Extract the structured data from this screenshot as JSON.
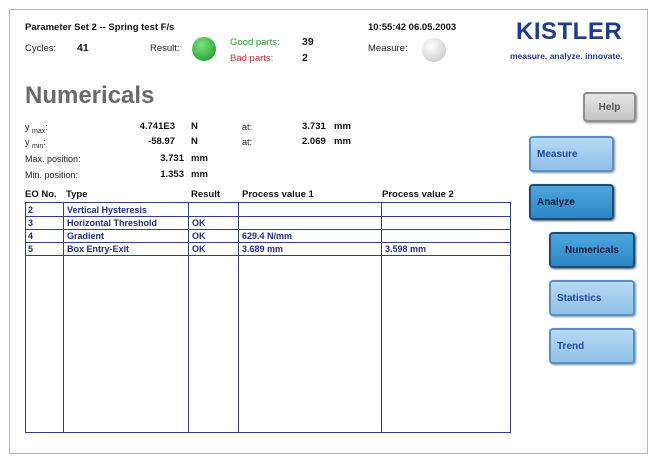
{
  "header": {
    "parameter_set": "Parameter Set 2  --  Spring test F/s",
    "datetime": "10:55:42  06.05.2003",
    "cycles_label": "Cycles:",
    "cycles_value": "41",
    "result_label": "Result:",
    "result_color": "#2fae3b",
    "good_parts_label": "Good parts:",
    "good_parts_value": "39",
    "bad_parts_label": "Bad parts:",
    "bad_parts_value": "2",
    "measure_label": "Measure:"
  },
  "logo": {
    "name": "KISTLER",
    "tagline": "measure. analyze. innovate."
  },
  "page_title": "Numericals",
  "stats": {
    "ymax_label_main": "y",
    "ymax_label_sub": "max",
    "ymax_value": "4.741E3",
    "ymax_unit": "N",
    "ymax_at_label": "at:",
    "ymax_at_value": "3.731",
    "ymax_at_unit": "mm",
    "ymin_label_main": "y",
    "ymin_label_sub": "min",
    "ymin_value": "-58.97",
    "ymin_unit": "N",
    "ymin_at_label": "at:",
    "ymin_at_value": "2.069",
    "ymin_at_unit": "mm",
    "maxpos_label": "Max. position:",
    "maxpos_value": "3.731",
    "maxpos_unit": "mm",
    "minpos_label": "Min. position:",
    "minpos_value": "1.353",
    "minpos_unit": "mm"
  },
  "table": {
    "headers": [
      "EO No.",
      "Type",
      "Result",
      "Process value 1",
      "Process value 2"
    ],
    "rows": [
      {
        "eo": "2",
        "type": "Vertical Hysteresis",
        "result": "",
        "pv1": "",
        "pv2": ""
      },
      {
        "eo": "3",
        "type": "Horizontal Threshold",
        "result": "OK",
        "pv1": "",
        "pv2": ""
      },
      {
        "eo": "4",
        "type": "Gradient",
        "result": "OK",
        "pv1": "629.4 N/mm",
        "pv2": ""
      },
      {
        "eo": "5",
        "type": "Box Entry-Exit",
        "result": "OK",
        "pv1": "3.689 mm",
        "pv2": "3.598 mm"
      }
    ]
  },
  "nav": {
    "help": "Help",
    "measure": "Measure",
    "analyze": "Analyze",
    "numericals": "Numericals",
    "statistics": "Statistics",
    "trend": "Trend"
  }
}
